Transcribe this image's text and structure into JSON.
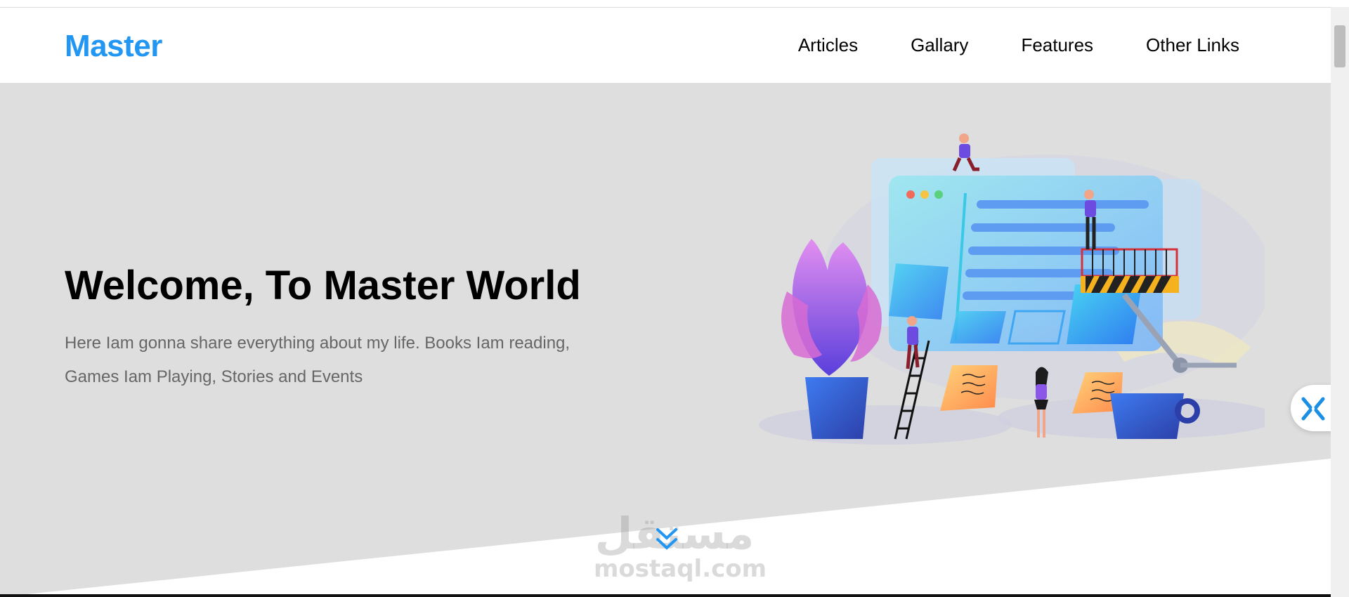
{
  "header": {
    "logo": "Master",
    "nav": [
      {
        "label": "Articles"
      },
      {
        "label": "Gallary"
      },
      {
        "label": "Features"
      },
      {
        "label": "Other Links"
      }
    ]
  },
  "hero": {
    "title": "Welcome, To Master World",
    "text": "Here Iam gonna share everything about my life. Books Iam reading, Games Iam Playing, Stories and Events"
  },
  "watermark": {
    "arabic": "مستقل",
    "latin": "mostaql.com"
  },
  "colors": {
    "accent": "#2196f3",
    "hero_bg": "#dedede",
    "text_muted": "#666666"
  },
  "icons": {
    "scroll_down": "double-chevron-down-icon",
    "side_widget": "close-x-icon"
  }
}
